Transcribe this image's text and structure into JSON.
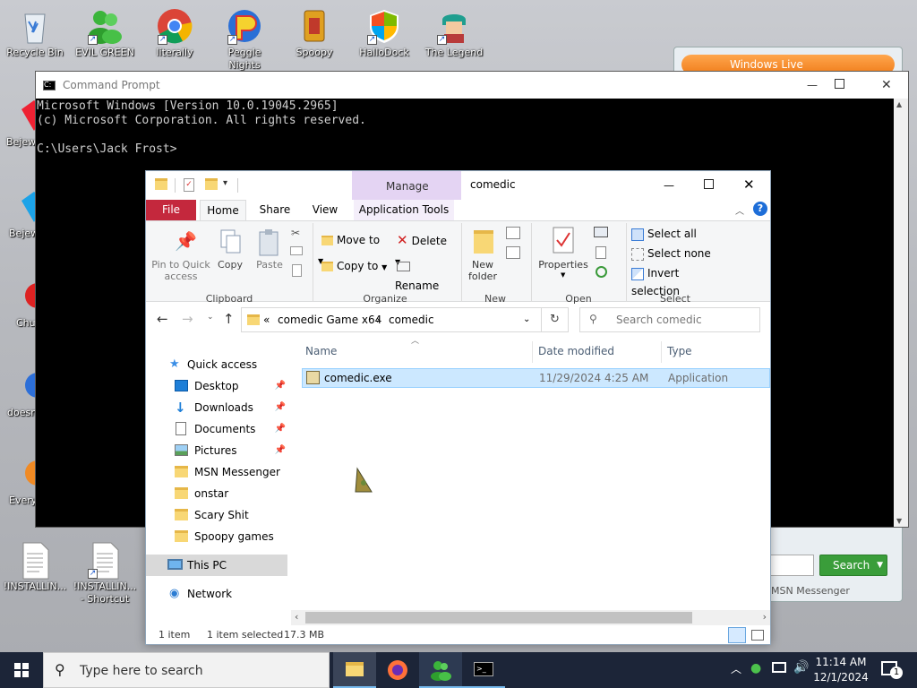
{
  "desktop": {
    "icons": [
      {
        "label": "Recycle Bin",
        "icon": "recycle-bin-icon"
      },
      {
        "label": "EVIL GREEN",
        "icon": "msn-buddy-icon"
      },
      {
        "label": "literally",
        "icon": "chrome-icon"
      },
      {
        "label": "Peggle Nights",
        "icon": "peggle-icon"
      },
      {
        "label": "Spoopy",
        "icon": "spoopy-icon"
      },
      {
        "label": "HalloDock",
        "icon": "shield-icon"
      },
      {
        "label": "The Legend",
        "icon": "legend-icon"
      },
      {
        "label": "Bejew",
        "icon": "bejeweled-icon"
      },
      {
        "label": "Bejew",
        "icon": "bejeweled-icon"
      },
      {
        "label": "Chu",
        "icon": "chuzzle-icon"
      },
      {
        "label": "doesn",
        "icon": "globe-icon"
      },
      {
        "label": "Every",
        "icon": "every-icon"
      },
      {
        "label": "!INSTALLIN...",
        "icon": "text-file-icon"
      },
      {
        "label": "!INSTALLIN...",
        "sub": "- Shortcut",
        "icon": "text-file-icon"
      }
    ]
  },
  "cmd": {
    "title": "Command Prompt",
    "lines": [
      "Microsoft Windows [Version 10.0.19045.2965]",
      "(c) Microsoft Corporation. All rights reserved.",
      "",
      "C:\\Users\\Jack Frost>"
    ]
  },
  "msn": {
    "title": "Windows Live",
    "search_label": "Search",
    "status": "MSN Messenger"
  },
  "explorer": {
    "title": "comedic",
    "context_tab": "Manage",
    "tabs": {
      "file": "File",
      "home": "Home",
      "share": "Share",
      "view": "View",
      "app_tools": "Application Tools"
    },
    "ribbon": {
      "pin": "Pin to Quick access",
      "copy": "Copy",
      "paste": "Paste",
      "move_to": "Move to",
      "copy_to": "Copy to",
      "delete": "Delete",
      "rename": "Rename",
      "new_folder": "New folder",
      "properties": "Properties",
      "select_all": "Select all",
      "select_none": "Select none",
      "invert": "Invert selection",
      "groups": {
        "clipboard": "Clipboard",
        "organize": "Organize",
        "new": "New",
        "open": "Open",
        "select": "Select"
      }
    },
    "path": {
      "prefix": "«",
      "crumb1": "comedic Game x64",
      "sep": "›",
      "crumb2": "comedic"
    },
    "search_placeholder": "Search comedic",
    "columns": {
      "name": "Name",
      "date": "Date modified",
      "type": "Type"
    },
    "files": [
      {
        "name": "comedic.exe",
        "date": "11/29/2024 4:25 AM",
        "type": "Application"
      }
    ],
    "nav": {
      "quick_access": "Quick access",
      "items": [
        {
          "label": "Desktop",
          "pinned": true,
          "icon": "desktop-icon"
        },
        {
          "label": "Downloads",
          "pinned": true,
          "icon": "download-icon"
        },
        {
          "label": "Documents",
          "pinned": true,
          "icon": "documents-icon"
        },
        {
          "label": "Pictures",
          "pinned": true,
          "icon": "pictures-icon"
        },
        {
          "label": "MSN Messenger",
          "icon": "folder-icon"
        },
        {
          "label": "onstar",
          "icon": "folder-icon"
        },
        {
          "label": "Scary Shit",
          "icon": "folder-icon"
        },
        {
          "label": "Spoopy games",
          "icon": "folder-icon"
        }
      ],
      "this_pc": "This PC",
      "network": "Network"
    },
    "status": {
      "count": "1 item",
      "selected": "1 item selected",
      "size": "17.3 MB"
    }
  },
  "taskbar": {
    "search_placeholder": "Type here to search",
    "time": "11:14 AM",
    "date": "12/1/2024",
    "notifications": "1"
  }
}
